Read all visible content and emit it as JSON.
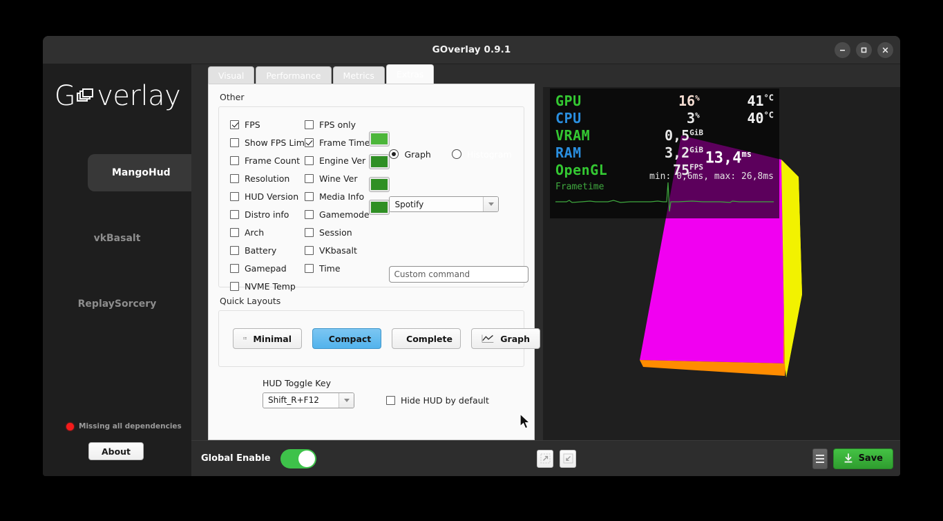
{
  "window": {
    "title": "GOverlay 0.9.1",
    "controls": [
      {
        "name": "minimize",
        "glyph": "minimize-icon"
      },
      {
        "name": "maximize",
        "glyph": "maximize-icon"
      },
      {
        "name": "close",
        "glyph": "close-icon"
      }
    ]
  },
  "sidebar": {
    "logo_pre": "G",
    "logo_post": "verlay",
    "logo_icon": "stacked-windows-icon",
    "items": [
      {
        "label": "MangoHud",
        "active": true
      },
      {
        "label": "vkBasalt",
        "active": false
      },
      {
        "label": "ReplaySorcery",
        "active": false
      }
    ],
    "status": {
      "text": "Missing all dependencies",
      "dot_color": "#f41b1b"
    },
    "about_label": "About"
  },
  "tabs": [
    {
      "label": "Visual",
      "active": false
    },
    {
      "label": "Performance",
      "active": false
    },
    {
      "label": "Metrics",
      "active": false
    },
    {
      "label": "Extras",
      "active": true
    }
  ],
  "other": {
    "group_label": "Other",
    "col1": [
      {
        "label": "FPS",
        "checked": true
      },
      {
        "label": "Show FPS Lim",
        "checked": false
      },
      {
        "label": "Frame Count",
        "checked": false
      },
      {
        "label": "Resolution",
        "checked": false
      },
      {
        "label": "HUD Version",
        "checked": false
      },
      {
        "label": "Distro info",
        "checked": false
      },
      {
        "label": "Arch",
        "checked": false
      },
      {
        "label": "Battery",
        "checked": false
      },
      {
        "label": "Gamepad",
        "checked": false
      },
      {
        "label": "NVME Temp",
        "checked": false
      }
    ],
    "col2": [
      {
        "label": "FPS only",
        "checked": false
      },
      {
        "label": "Frame Time",
        "checked": true
      },
      {
        "label": "Engine Ver",
        "checked": false
      },
      {
        "label": "Wine Ver",
        "checked": false
      },
      {
        "label": "Media Info",
        "checked": false
      },
      {
        "label": "Gamemode",
        "checked": false
      },
      {
        "label": "Session",
        "checked": false
      },
      {
        "label": "VKbasalt",
        "checked": false
      },
      {
        "label": "Time",
        "checked": false
      }
    ],
    "swatches": [
      "#4cb63a",
      "#2f8f24",
      "#2f8f24",
      "#2f8f24"
    ],
    "graph_radio": {
      "label": "Graph",
      "selected": true
    },
    "histogram_radio": {
      "label": "Histogram",
      "selected": false
    },
    "media_player": {
      "value": "Spotify"
    },
    "custom_command": {
      "placeholder": "Custom command",
      "value": ""
    }
  },
  "quick_layouts": {
    "label": "Quick Layouts",
    "buttons": [
      {
        "label": "Minimal",
        "icon": "list-minimal-icon",
        "hovered": false
      },
      {
        "label": "Compact",
        "icon": "list-compact-icon",
        "hovered": true
      },
      {
        "label": "Complete",
        "icon": "bars-icon",
        "hovered": false
      },
      {
        "label": "Graph",
        "icon": "line-chart-icon",
        "hovered": false
      }
    ]
  },
  "hud_toggle": {
    "label": "HUD Toggle Key",
    "value": "Shift_R+F12",
    "hide_checkbox": {
      "label": "Hide HUD by default",
      "checked": false
    }
  },
  "preview": {
    "rows": [
      {
        "name": "GPU",
        "name_color": "#34c832",
        "value": "16",
        "unit": "%",
        "value_color": "#f5ddd2",
        "temp": "41",
        "temp_unit": "°C"
      },
      {
        "name": "CPU",
        "name_color": "#2a8fe0",
        "value": "3",
        "unit": "%",
        "value_color": "#e9e9e9",
        "temp": "40",
        "temp_unit": "°C"
      },
      {
        "name": "VRAM",
        "name_color": "#34c832",
        "value": "0,5",
        "unit": "GiB",
        "value_color": "#e9e9e9",
        "temp": "",
        "temp_unit": ""
      },
      {
        "name": "RAM",
        "name_color": "#2a8fe0",
        "value": "3,2",
        "unit": "GiB",
        "value_color": "#e9e9e9",
        "temp": "",
        "temp_unit": ""
      },
      {
        "name": "OpenGL",
        "name_color": "#34c832",
        "value": "75",
        "unit": "FPS",
        "value_color": "#e9e9e9",
        "temp": "",
        "temp_unit": ""
      }
    ],
    "frametime_label": "Frametime",
    "frametime_value": "13,4",
    "frametime_unit": "ms",
    "frametime_minmax": "min: 0,6ms, max: 26,8ms",
    "graph_color": "#3fa93f"
  },
  "bottom": {
    "global_enable_label": "Global Enable",
    "global_enable_on": true,
    "expand_icon": "expand-icon",
    "collapse_icon": "collapse-icon",
    "menu_icon": "hamburger-icon",
    "save_label": "Save",
    "save_icon": "download-icon",
    "save_color": "#3aad3a"
  }
}
